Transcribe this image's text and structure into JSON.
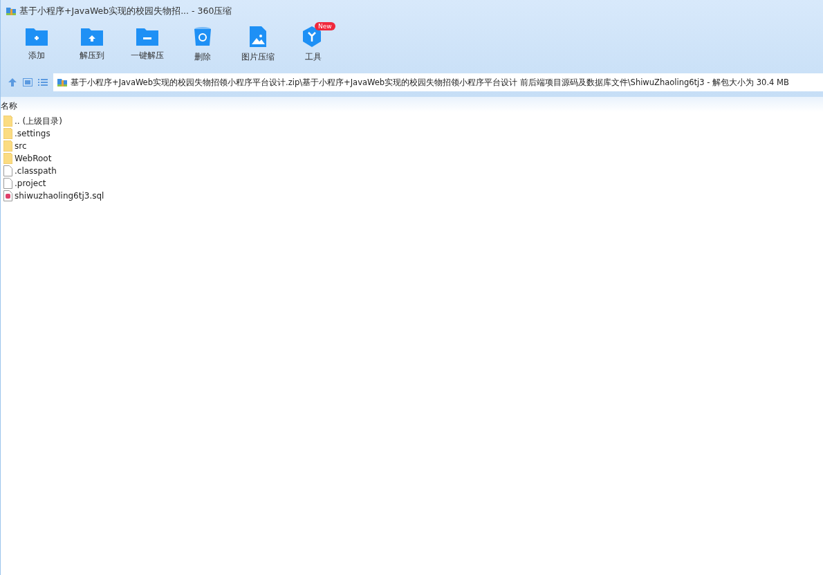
{
  "window": {
    "title": "基于小程序+JavaWeb实现的校园失物招... - 360压缩"
  },
  "toolbar": [
    {
      "kind": "add",
      "label": "添加"
    },
    {
      "kind": "extract-to",
      "label": "解压到"
    },
    {
      "kind": "one-click",
      "label": "一键解压"
    },
    {
      "kind": "delete",
      "label": "删除"
    },
    {
      "kind": "image",
      "label": "图片压缩"
    },
    {
      "kind": "tools",
      "label": "工具",
      "badge": "New"
    }
  ],
  "address": {
    "value": "基于小程序+JavaWeb实现的校园失物招领小程序平台设计.zip\\基于小程序+JavaWeb实现的校园失物招领小程序平台设计 前后端项目源码及数据库文件\\ShiwuZhaoling6tj3 - 解包大小为 30.4 MB"
  },
  "file_list": {
    "columns": [
      "名称"
    ],
    "rows": [
      {
        "kind": "folder",
        "name": ".. (上级目录)"
      },
      {
        "kind": "folder",
        "name": ".settings"
      },
      {
        "kind": "folder",
        "name": "src"
      },
      {
        "kind": "folder",
        "name": "WebRoot"
      },
      {
        "kind": "file",
        "name": ".classpath"
      },
      {
        "kind": "file",
        "name": ".project"
      },
      {
        "kind": "sql",
        "name": "shiwuzhaoling6tj3.sql"
      }
    ]
  }
}
